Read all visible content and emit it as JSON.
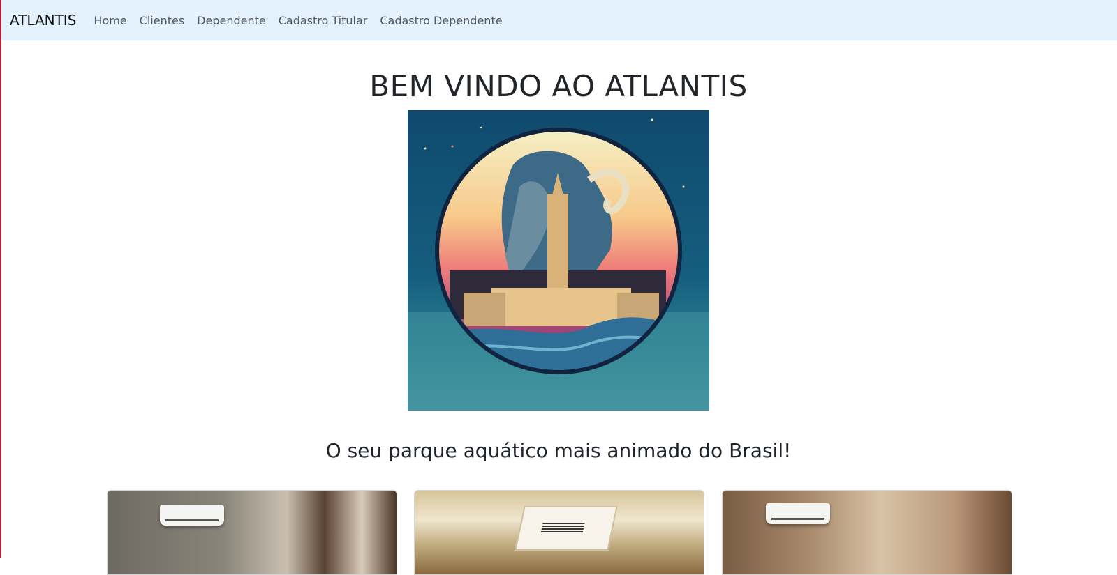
{
  "navbar": {
    "brand": "ATLANTIS",
    "links": [
      {
        "label": "Home"
      },
      {
        "label": "Clientes"
      },
      {
        "label": "Dependente"
      },
      {
        "label": "Cadastro Titular"
      },
      {
        "label": "Cadastro Dependente"
      }
    ]
  },
  "main": {
    "title": "BEM VINDO AO ATLANTIS",
    "subtitle": "O seu parque aquático mais animado do Brasil!"
  },
  "colors": {
    "navbar_bg": "#e3f2fd",
    "text": "#212529",
    "nav_link": "#555a60"
  }
}
